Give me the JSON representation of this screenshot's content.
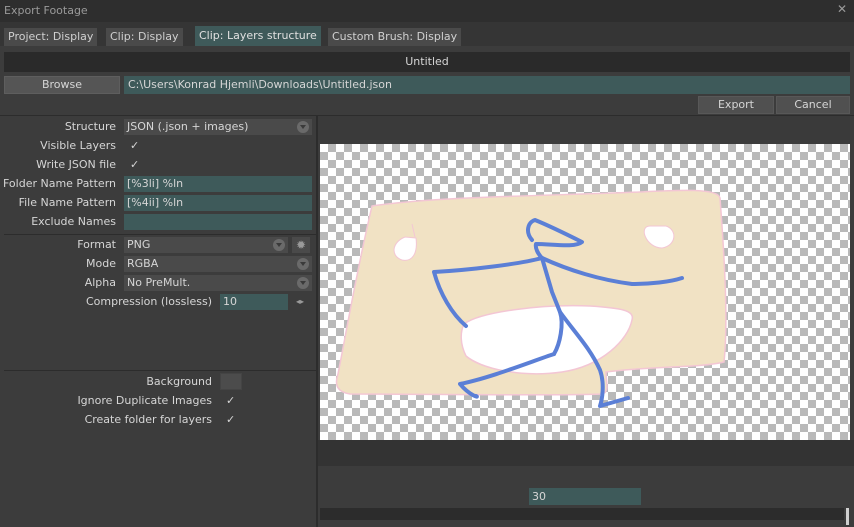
{
  "window": {
    "title": "Export Footage",
    "close_icon": "close-icon"
  },
  "tabs": [
    {
      "label": "Project: Display"
    },
    {
      "label": "Clip: Display"
    },
    {
      "label": "Clip: Layers structure"
    },
    {
      "label": "Custom Brush: Display"
    }
  ],
  "active_tab": "Clip: Layers structure",
  "filename": "Untitled",
  "browse_label": "Browse",
  "path_value": "C:\\Users\\Konrad Hjemli\\Downloads\\Untitled.json",
  "export_label": "Export",
  "cancel_label": "Cancel",
  "settings": {
    "structure_label": "Structure",
    "structure_value": "JSON (.json + images)",
    "visible_layers_label": "Visible Layers",
    "write_json_label": "Write JSON file",
    "folder_name_label": "Folder Name Pattern",
    "folder_name_value": "[%3li] %ln",
    "file_name_label": "File Name Pattern",
    "file_name_value": "[%4ii] %ln",
    "exclude_names_label": "Exclude Names",
    "exclude_names_value": "",
    "format_label": "Format",
    "format_value": "PNG",
    "mode_label": "Mode",
    "mode_value": "RGBA",
    "alpha_label": "Alpha",
    "alpha_value": "No PreMult.",
    "compression_label": "Compression (lossless)",
    "compression_value": "10",
    "background_label": "Background",
    "ignore_duplicates_label": "Ignore Duplicate Images",
    "create_folder_label": "Create folder for layers",
    "checkmark": "✓"
  },
  "preview": {
    "frame_value": "30"
  },
  "colors": {
    "accent_field": "#3e5a5a",
    "active_tab": "#3f5a5a",
    "sketch_fill": "#f1e2c4",
    "sketch_stroke": "#5b7fd6"
  }
}
